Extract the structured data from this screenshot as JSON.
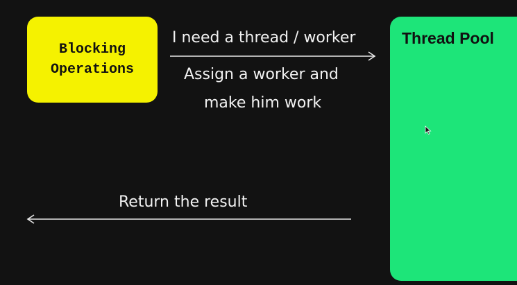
{
  "colors": {
    "background": "#121212",
    "blocking": "#f5f200",
    "pool": "#1de579",
    "text": "#f2f2f2",
    "arrow": "#e8e8e8"
  },
  "blocking_box": {
    "line1": "Blocking",
    "line2": "Operations"
  },
  "thread_pool": {
    "title": "Thread Pool"
  },
  "messages": {
    "request": "I need a thread / worker",
    "assign_line1": "Assign a worker and",
    "assign_line2": "make him work",
    "return": "Return the result"
  }
}
